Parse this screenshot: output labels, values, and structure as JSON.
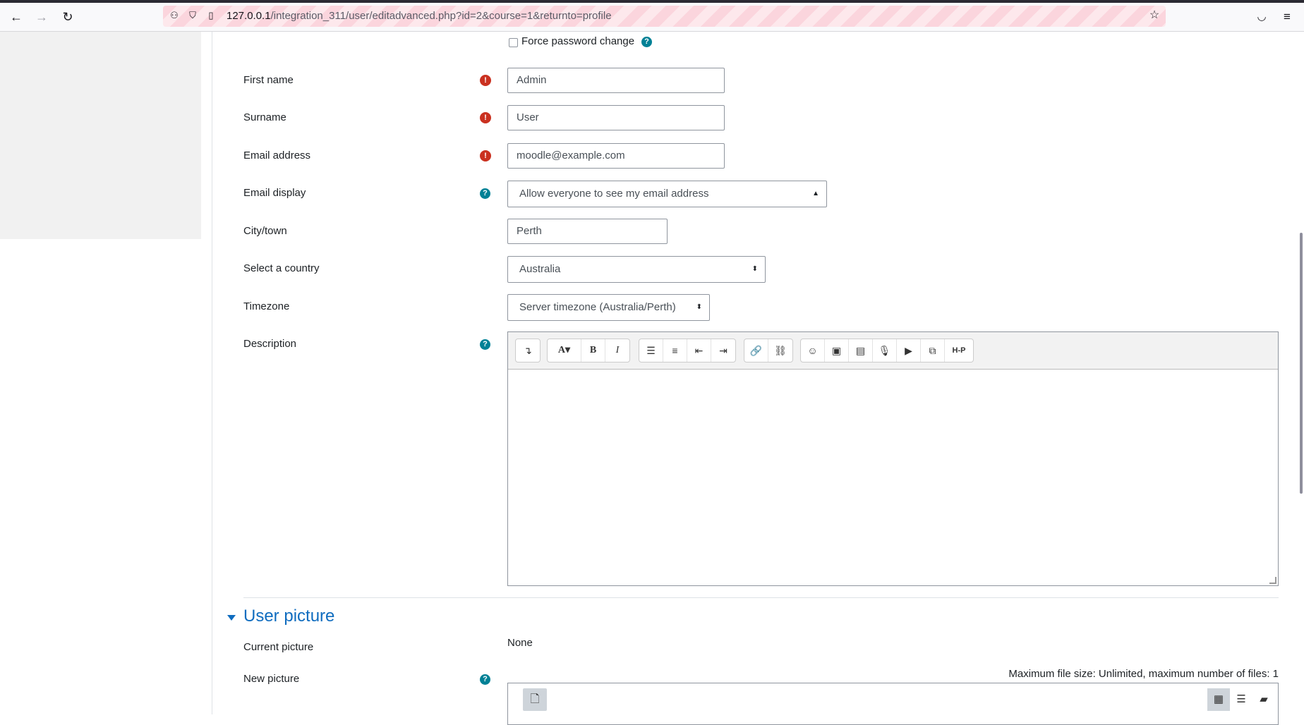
{
  "browser": {
    "url_host": "127.0.0.1",
    "url_path": "/integration_311/user/editadvanced.php?id=2&course=1&returnto=profile"
  },
  "form": {
    "force_password_change_label": "Force password change",
    "fields": {
      "first_name": {
        "label": "First name",
        "value": "Admin"
      },
      "surname": {
        "label": "Surname",
        "value": "User"
      },
      "email": {
        "label": "Email address",
        "value": "moodle@example.com"
      },
      "email_display": {
        "label": "Email display",
        "value": "Allow everyone to see my email address"
      },
      "city": {
        "label": "City/town",
        "value": "Perth"
      },
      "country": {
        "label": "Select a country",
        "value": "Australia"
      },
      "timezone": {
        "label": "Timezone",
        "value": "Server timezone (Australia/Perth)"
      },
      "description": {
        "label": "Description",
        "value": ""
      }
    }
  },
  "editor": {
    "toolbar": {
      "collapse": "↴",
      "font": "A▾",
      "bold": "B",
      "italic": "I",
      "bullets": "☰",
      "numbered": "≡",
      "outdent": "⇤",
      "indent": "⇥",
      "link": "🔗",
      "unlink": "⛓",
      "emoji": "☺",
      "image": "▣",
      "media": "▤",
      "record_audio": "🎙",
      "record_video": "▶",
      "manage_files": "⧉",
      "h5p": "H-P"
    }
  },
  "user_picture": {
    "section_title": "User picture",
    "current_label": "Current picture",
    "current_value": "None",
    "new_label": "New picture",
    "max_info": "Maximum file size: Unlimited, maximum number of files: 1"
  },
  "colors": {
    "accent": "#0f6cbf",
    "required": "#ca3120",
    "help": "#008196"
  }
}
